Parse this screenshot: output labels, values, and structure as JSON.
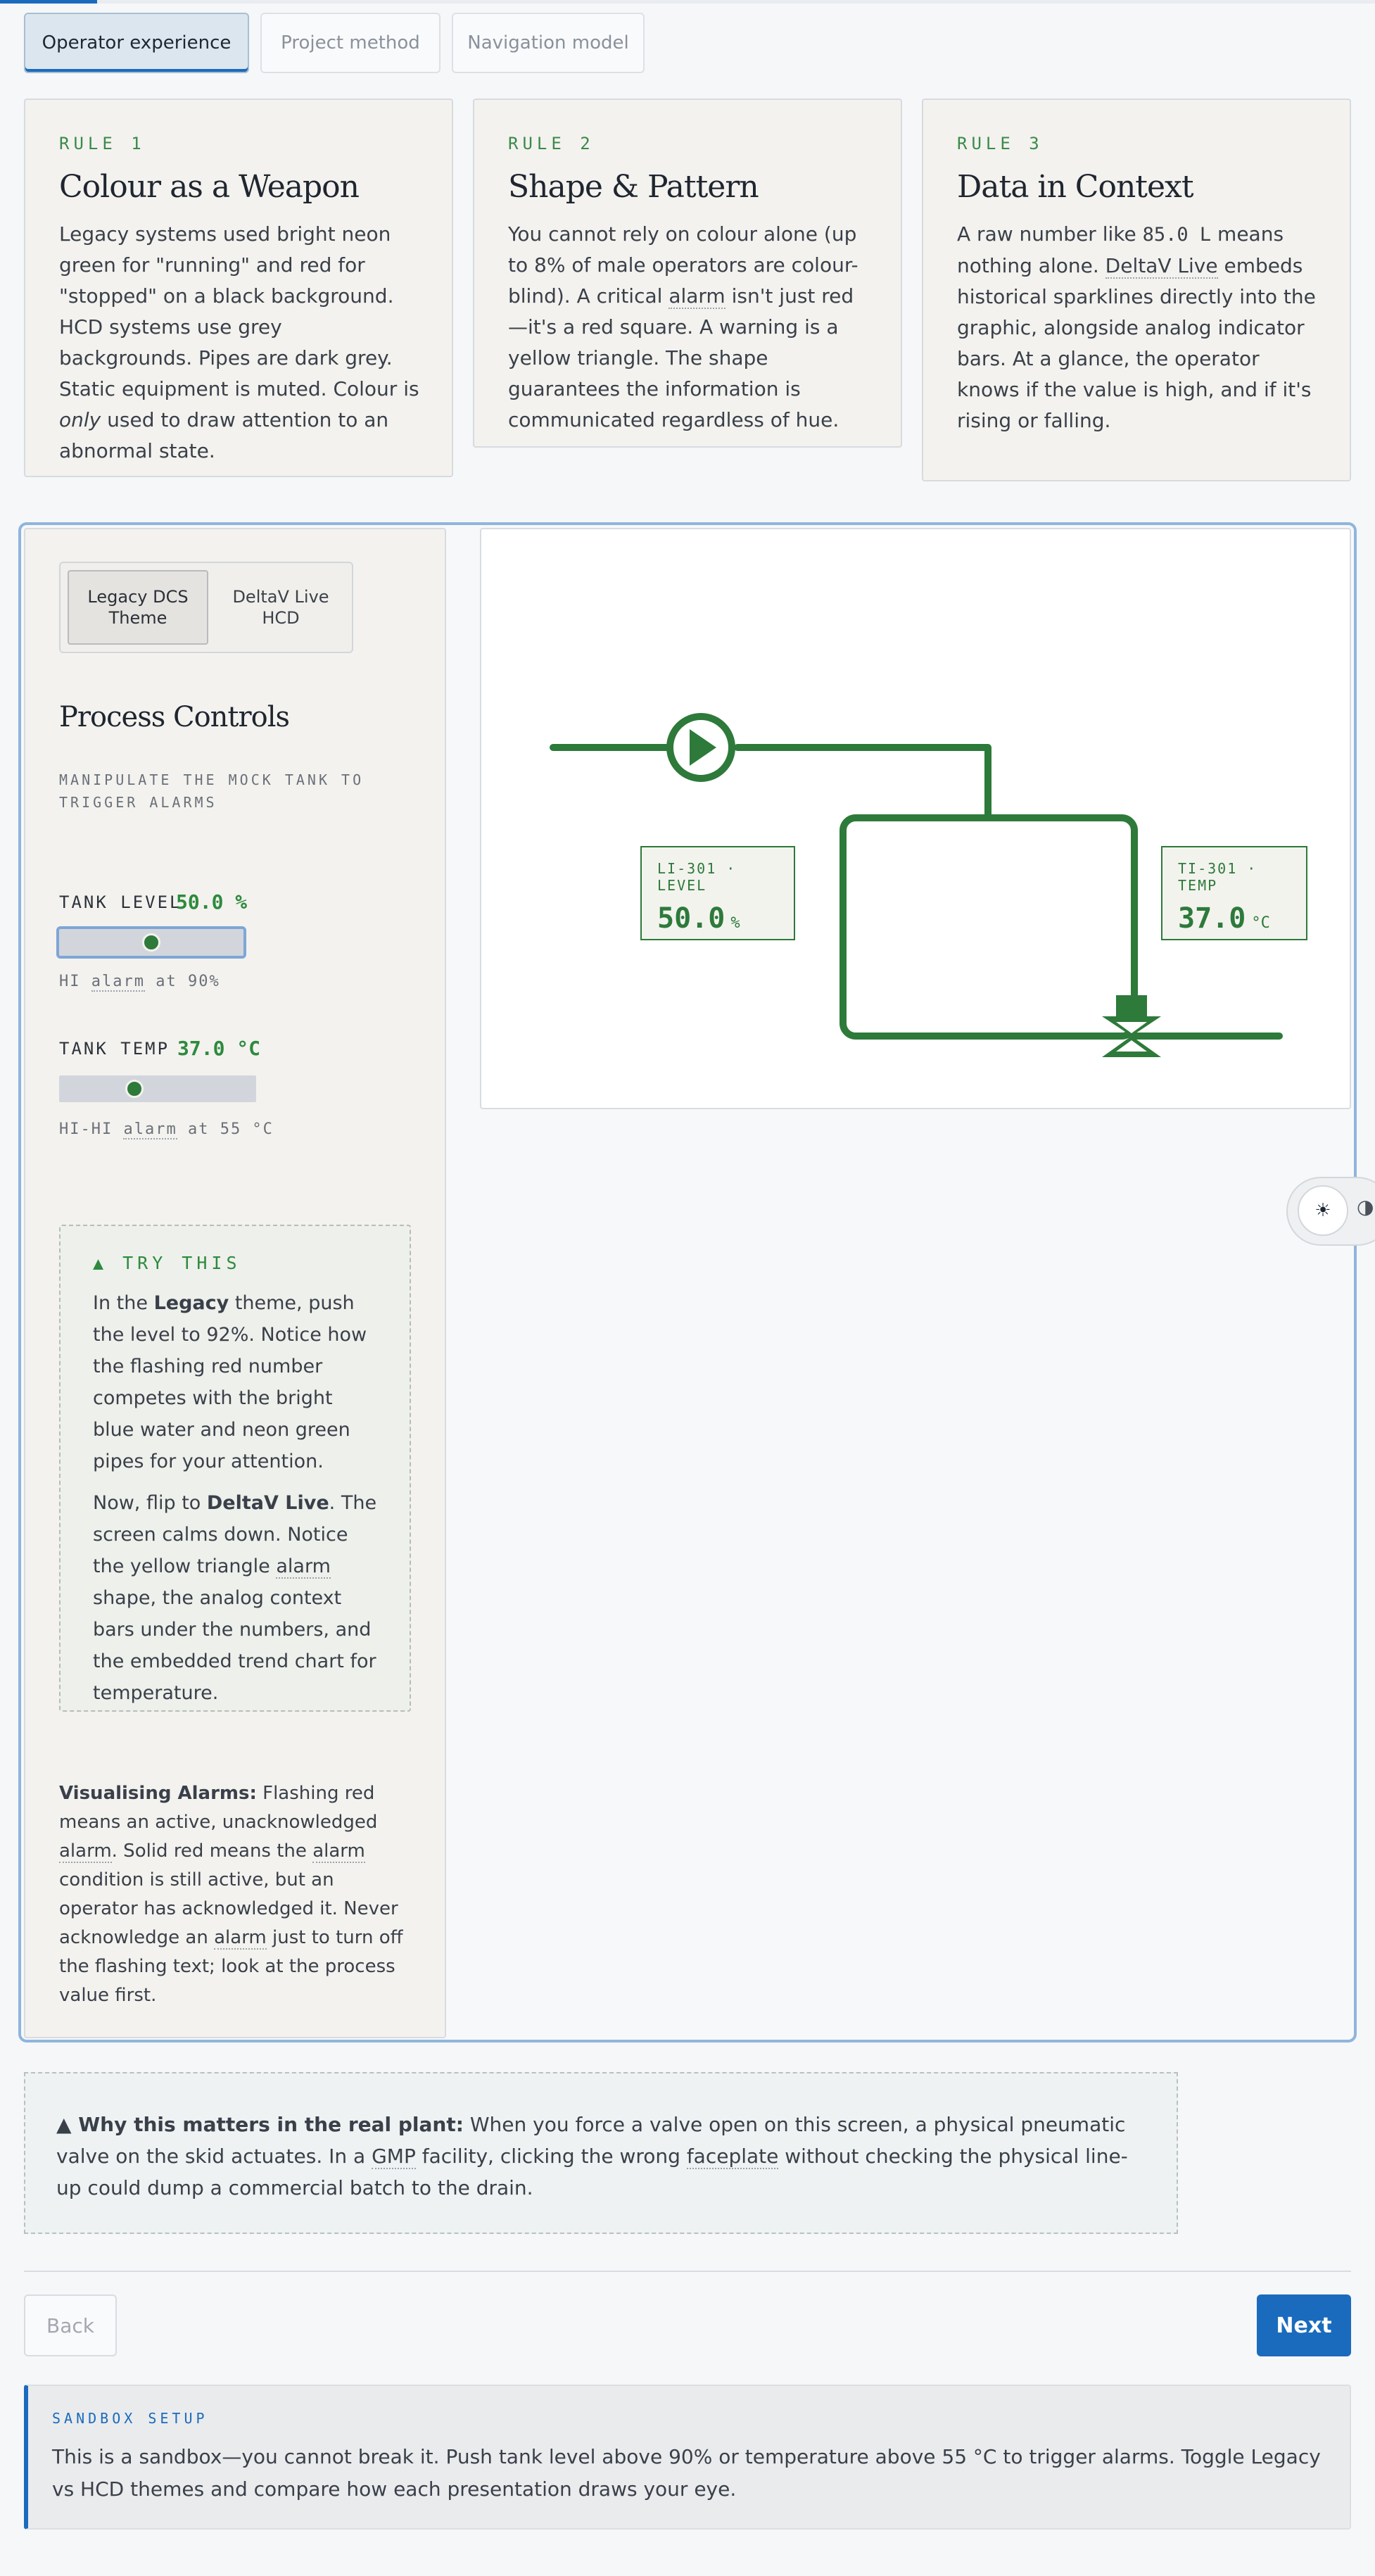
{
  "tabs": [
    {
      "label": "Operator experience"
    },
    {
      "label": "Project method"
    },
    {
      "label": "Navigation model"
    }
  ],
  "rules": [
    {
      "kicker": "RULE 1",
      "title": "Colour as a Weapon",
      "body_1": "Legacy systems used bright neon green for \"running\" and red for \"stopped\" on a black background. HCD systems use grey backgrounds. Pipes are dark grey. Static equipment is muted. Colour is ",
      "body_em": "only",
      "body_2": " used to draw attention to an abnormal state."
    },
    {
      "kicker": "RULE 2",
      "title": "Shape & Pattern",
      "body_1": "You cannot rely on colour alone (up to 8% of male operators are colour-blind). A critical ",
      "body_term": "alarm",
      "body_2": " isn't just red—it's a red square. A warning is a yellow triangle. The shape guarantees the information is communicated regardless of hue."
    },
    {
      "kicker": "RULE 3",
      "title": "Data in Context",
      "body_1": "A raw number like ",
      "body_code": "85.0 L",
      "body_2": " means nothing alone. ",
      "body_term": "DeltaV Live",
      "body_3": " embeds historical sparklines directly into the graphic, alongside analog indicator bars. At a glance, the operator knows if the value is high, and if it's rising or falling."
    }
  ],
  "theme": {
    "legacy_label": "Legacy DCS Theme",
    "hcd_label": "DeltaV Live HCD"
  },
  "controls": {
    "title": "Process Controls",
    "subtitle": "MANIPULATE THE MOCK TANK TO TRIGGER ALARMS",
    "level_label": "TANK LEVEL",
    "level_value": "50.0 %",
    "level_fraction": 0.5,
    "level_hint_1": "HI ",
    "level_hint_term": "alarm",
    "level_hint_2": " at 90%",
    "temp_label": "TANK TEMP",
    "temp_value": "37.0 °C",
    "temp_fraction": 0.37,
    "temp_hint_1": "HI-HI ",
    "temp_hint_term": "alarm",
    "temp_hint_2": " at 55 °C"
  },
  "try_this": {
    "heading": "▲ TRY THIS",
    "p1_a": "In the ",
    "p1_b": "Legacy",
    "p1_c": " theme, push the level to 92%. Notice how the flashing red number competes with the bright blue water and neon green pipes for your attention.",
    "p2_a": "Now, flip to ",
    "p2_b": "DeltaV Live",
    "p2_c": ". The screen calms down. Notice the yellow triangle ",
    "p2_term": "alarm",
    "p2_d": " shape, the analog context bars under the numbers, and the embedded trend chart for temperature."
  },
  "visualising": {
    "lead": "Visualising Alarms:",
    "t1": " Flashing red means an active, unacknowledged ",
    "term1": "alarm",
    "t2": ". Solid red means the ",
    "term2": "alarm",
    "t3": " condition is still active, but an operator has acknowledged it. Never acknowledge an ",
    "term3": "alarm",
    "t4": " just to turn off the flashing text; look at the process value first."
  },
  "faceplates": {
    "level": {
      "tag": "LI-301 · LEVEL",
      "value": "50.0",
      "unit": "%"
    },
    "temp": {
      "tag": "TI-301 · TEMP",
      "value": "37.0",
      "unit": "°C"
    }
  },
  "side_toggle": {
    "sun_glyph": "☀",
    "contrast_glyph": "◑"
  },
  "why": {
    "lead": "▲ Why this matters in the real plant:",
    "t1": " When you force a valve open on this screen, a physical pneumatic valve on the skid actuates. In a ",
    "term1": "GMP",
    "t2": " facility, clicking the wrong ",
    "term2": "faceplate",
    "t3": " without checking the physical line-up could dump a commercial batch to the drain."
  },
  "nav": {
    "back": "Back",
    "next": "Next"
  },
  "setup": {
    "kicker": "SANDBOX SETUP",
    "text": "This is a sandbox—you cannot break it. Push tank level above 90% or temperature above 55 °C to trigger alarms. Toggle Legacy vs HCD themes and compare how each presentation draws your eye."
  },
  "colors": {
    "accent": "#1a6bbd",
    "pipe_green": "#2d7a3a",
    "label_green": "#2d8a3e"
  },
  "icons": {
    "pump": "pump-icon",
    "valve": "valve-icon",
    "sun": "sun-icon",
    "contrast": "contrast-icon"
  }
}
